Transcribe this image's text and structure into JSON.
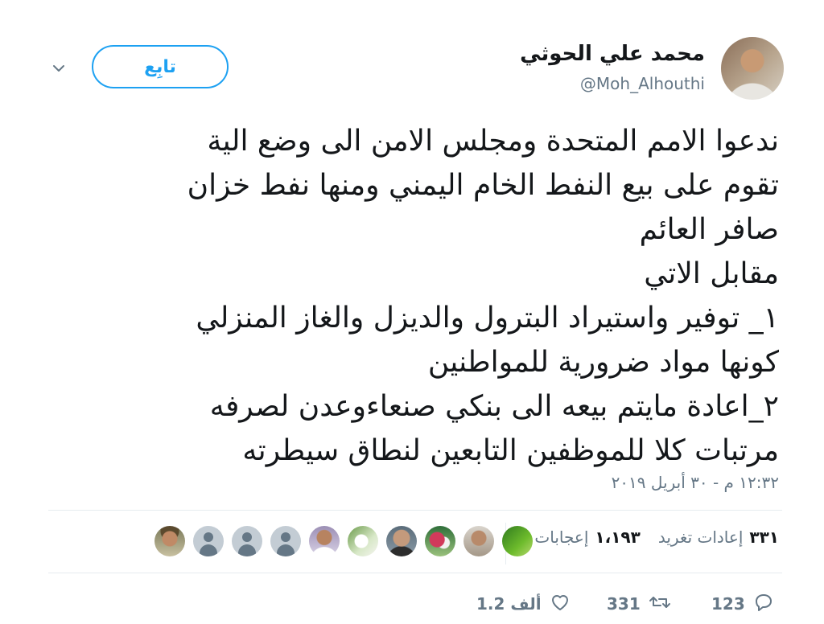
{
  "author": {
    "name": "محمد علي الحوثي",
    "handle": "@Moh_Alhouthi"
  },
  "follow_button": {
    "label": "تابِع"
  },
  "tweet": {
    "lines": [
      "ندعوا الامم المتحدة ومجلس الامن الى وضع الية",
      "تقوم على بيع النفط الخام اليمني ومنها نفط خزان",
      "صافر العائم",
      "مقابل الاتي",
      "١_ توفير واستيراد البترول والديزل والغاز المنزلي",
      "كونها مواد ضرورية للمواطنين",
      "٢_اعادة مايتم بيعه الى بنكي صنعاءوعدن لصرفه",
      "مرتبات كلا للموظفين التابعين لنطاق سيطرته"
    ],
    "timestamp": "١٢:٣٢ م - ٣٠ أبريل ٢٠١٩"
  },
  "stats": {
    "retweets_count": "٣٣١",
    "retweets_label": "إعادات تغريد",
    "likes_count": "١،١٩٣",
    "likes_label": "إعجابات"
  },
  "actions": {
    "reply_count": "123",
    "retweet_count": "331",
    "like_count": "1.2 ألف"
  },
  "colors": {
    "accent": "#1da1f2",
    "muted": "#657786",
    "divider": "#e6ecf0"
  },
  "icons": [
    "chevron-down-icon",
    "reply-icon",
    "retweet-icon",
    "heart-icon"
  ]
}
